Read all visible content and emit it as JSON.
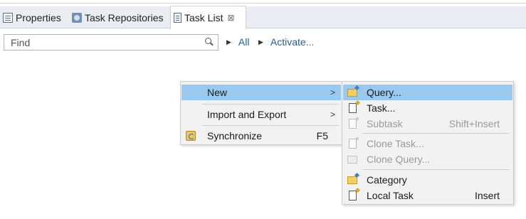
{
  "tabs": [
    {
      "label": "Properties",
      "icon": "properties-icon"
    },
    {
      "label": "Task Repositories",
      "icon": "task-repositories-icon"
    },
    {
      "label": "Task List",
      "icon": "task-list-icon",
      "active": true,
      "close": "⊠"
    }
  ],
  "find": {
    "placeholder": "Find",
    "value": ""
  },
  "links": [
    {
      "label": "All"
    },
    {
      "label": "Activate..."
    }
  ],
  "context_menu": {
    "items": [
      {
        "label": "New",
        "has_submenu": true,
        "selected": true
      },
      {
        "label": "Import and Export",
        "has_submenu": true
      },
      {
        "label": "Synchronize",
        "shortcut": "F5",
        "icon": "synchronize-icon"
      }
    ]
  },
  "new_submenu": {
    "items": [
      {
        "label": "Query...",
        "icon": "query-icon",
        "selected": true
      },
      {
        "label": "Task...",
        "icon": "task-icon"
      },
      {
        "label": "Subtask",
        "shortcut": "Shift+Insert",
        "disabled": true,
        "icon": "subtask-icon"
      },
      {
        "label": "Clone Task...",
        "disabled": true,
        "icon": "clone-task-icon"
      },
      {
        "label": "Clone Query...",
        "disabled": true,
        "icon": "clone-query-icon"
      },
      {
        "label": "Category",
        "icon": "category-icon"
      },
      {
        "label": "Local Task",
        "shortcut": "Insert",
        "icon": "local-task-icon"
      }
    ]
  },
  "colors": {
    "selection": "#99c9ef",
    "link": "#1f5fa8",
    "tabstrip": "#eaeef3",
    "menu_bg": "#f2f2f2",
    "disabled_text": "#9a9a9a"
  }
}
